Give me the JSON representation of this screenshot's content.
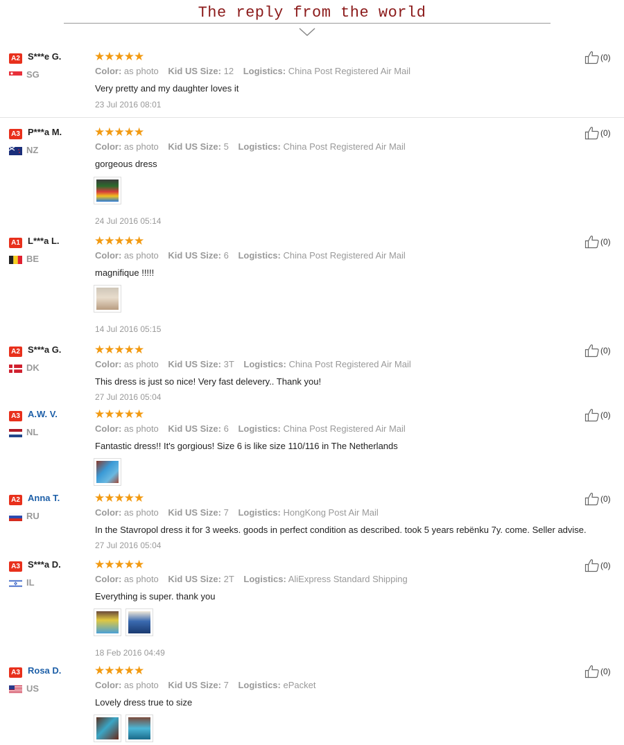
{
  "header": {
    "title": "The reply from the world"
  },
  "labels": {
    "color": "Color:",
    "size": "Kid US Size:",
    "logistics": "Logistics:"
  },
  "colors": {
    "stars": "#f29a12",
    "level_badge": "#e8301c",
    "title": "#8b1a1a",
    "link_name": "#1d5fa8"
  },
  "reviews": [
    {
      "level": "A2",
      "name": "S***e G.",
      "country": "SG",
      "rating": 5,
      "color": "as photo",
      "size": "12",
      "logistics": "China Post Registered Air Mail",
      "text": "Very pretty and my daughter loves it",
      "date": "23 Jul 2016 08:01",
      "likes": "(0)"
    },
    {
      "level": "A3",
      "name": "P***a M.",
      "country": "NZ",
      "rating": 5,
      "color": "as photo",
      "size": "5",
      "logistics": "China Post Registered Air Mail",
      "text": "gorgeous dress",
      "date": "24 Jul 2016 05:14",
      "likes": "(0)"
    },
    {
      "level": "A1",
      "name": "L***a L.",
      "country": "BE",
      "rating": 5,
      "color": "as photo",
      "size": "6",
      "logistics": "China Post Registered Air Mail",
      "text": "magnifique !!!!!",
      "date": "14 Jul 2016 05:15",
      "likes": "(0)"
    },
    {
      "level": "A2",
      "name": "S***a G.",
      "country": "DK",
      "rating": 5,
      "color": "as photo",
      "size": "3T",
      "logistics": "China Post Registered Air Mail",
      "text": "This dress is just so nice! Very fast delevery.. Thank you!",
      "date": "27 Jul 2016 05:04",
      "likes": "(0)"
    },
    {
      "level": "A3",
      "name": "A.W. V.",
      "country": "NL",
      "rating": 5,
      "color": "as photo",
      "size": "6",
      "logistics": "China Post Registered Air Mail",
      "text": "Fantastic dress!! It's gorgious! Size 6 is like size 110/116 in The Netherlands",
      "date": "",
      "likes": "(0)"
    },
    {
      "level": "A2",
      "name": "Anna T.",
      "country": "RU",
      "rating": 5,
      "color": "as photo",
      "size": "7",
      "logistics": "HongKong Post Air Mail",
      "text": "In the Stavropol dress it for 3 weeks. goods in perfect condition as described. took 5 years rebënku 7y. come. Seller advise.",
      "date": "27 Jul 2016 05:04",
      "likes": "(0)"
    },
    {
      "level": "A3",
      "name": "S***a D.",
      "country": "IL",
      "rating": 5,
      "color": "as photo",
      "size": "2T",
      "logistics": "AliExpress Standard Shipping",
      "text": "Everything is super. thank you",
      "date": "18 Feb 2016 04:49",
      "likes": "(0)"
    },
    {
      "level": "A3",
      "name": "Rosa D.",
      "country": "US",
      "rating": 5,
      "color": "as photo",
      "size": "7",
      "logistics": "ePacket",
      "text": "Lovely dress true to size",
      "date": "",
      "likes": "(0)"
    }
  ]
}
